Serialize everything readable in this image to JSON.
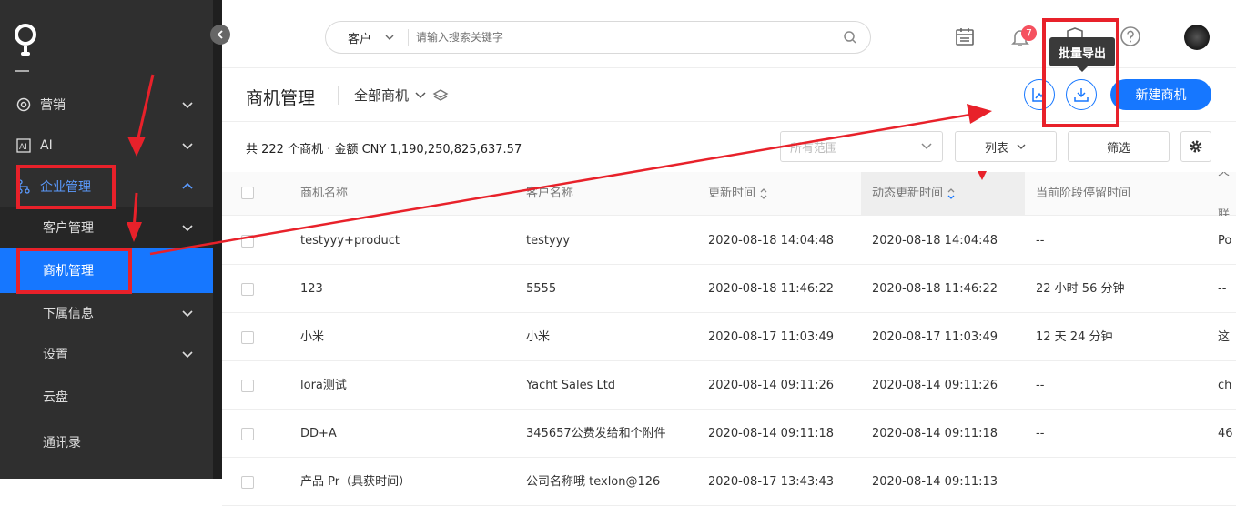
{
  "sidebar": {
    "items": [
      {
        "label": "营销",
        "icon": "target-icon"
      },
      {
        "label": "AI",
        "icon": "ai-icon"
      },
      {
        "label": "企业管理",
        "icon": "org-icon"
      },
      {
        "label": "客户管理"
      },
      {
        "label": "商机管理"
      },
      {
        "label": "下属信息"
      },
      {
        "label": "设置"
      },
      {
        "label": "云盘"
      },
      {
        "label": "通讯录"
      }
    ]
  },
  "search": {
    "type": "客户",
    "placeholder": "请输入搜索关键字"
  },
  "header": {
    "notification_count": "7",
    "tooltip": "批量导出"
  },
  "page": {
    "title": "商机管理",
    "view": "全部商机",
    "new_button": "新建商机",
    "summary": "共 222 个商机 · 金额 CNY 1,190,250,825,637.57",
    "range_placeholder": "所有范围",
    "list_button": "列表",
    "filter_button": "筛选"
  },
  "table": {
    "columns": [
      "商机名称",
      "客户名称",
      "更新时间",
      "动态更新时间",
      "当前阶段停留时间",
      "关联"
    ],
    "rows": [
      [
        "testyyy+product",
        "testyyy",
        "2020-08-18 14:04:48",
        "2020-08-18 14:04:48",
        "--",
        "Po"
      ],
      [
        "123",
        "5555",
        "2020-08-18 11:46:22",
        "2020-08-18 11:46:22",
        "22 小时 56 分钟",
        "--"
      ],
      [
        "小米",
        "小米",
        "2020-08-17 11:03:49",
        "2020-08-17 11:03:49",
        "12 天 24 分钟",
        "这"
      ],
      [
        "lora测试",
        "Yacht Sales Ltd",
        "2020-08-14 09:11:26",
        "2020-08-14 09:11:26",
        "--",
        "ch"
      ],
      [
        "DD+A",
        "345657公费发给和个附件",
        "2020-08-14 09:11:18",
        "2020-08-14 09:11:18",
        "--",
        "46"
      ],
      [
        "产品 Pr（具获时间）",
        "公司名称哦 texlon@126",
        "2020-08-17 13:43:43",
        "2020-08-14 09:11:13",
        "",
        ""
      ]
    ]
  }
}
